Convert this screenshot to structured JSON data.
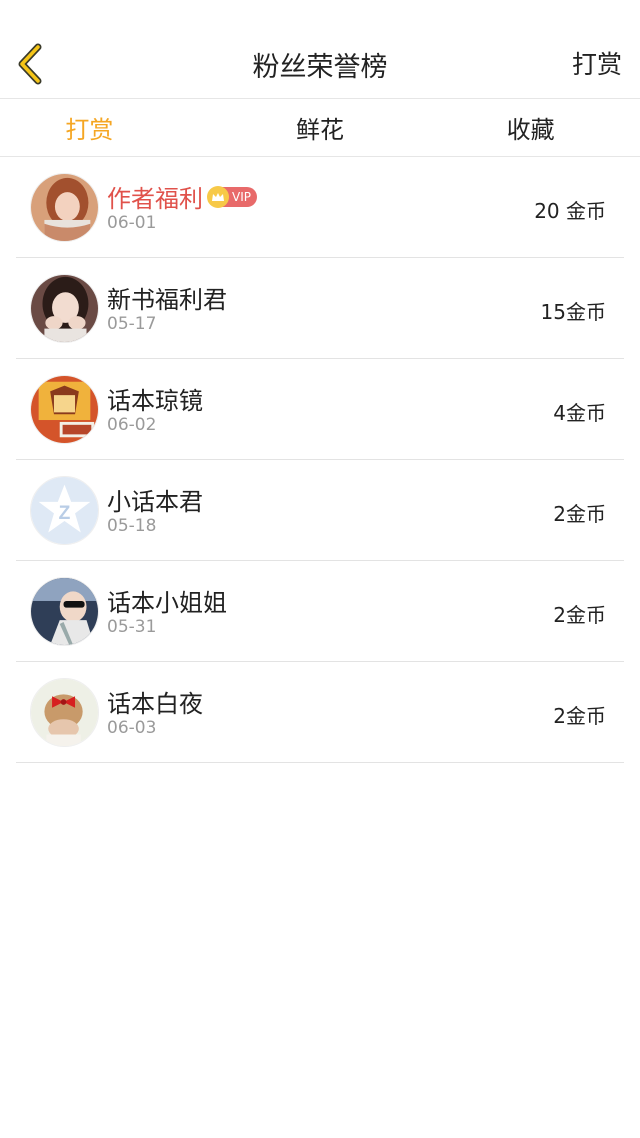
{
  "header": {
    "title": "粉丝荣誉榜",
    "right_action": "打赏"
  },
  "tabs": [
    {
      "label": "打赏",
      "active": true
    },
    {
      "label": "鲜花",
      "active": false
    },
    {
      "label": "收藏",
      "active": false
    }
  ],
  "colors": {
    "accent": "#f5a623",
    "highlight_name": "#e0524b",
    "vip_badge": "#e86a6a"
  },
  "fans": [
    {
      "name": "作者福利",
      "date": "06-01",
      "amount": "20 金币",
      "vip": true,
      "vip_label": "VIP",
      "avatar": "avatar-girl-scarf"
    },
    {
      "name": "新书福利君",
      "date": "05-17",
      "amount": "15金币",
      "vip": false,
      "avatar": "avatar-girl-hands"
    },
    {
      "name": "话本琼镜",
      "date": "06-02",
      "amount": "4金币",
      "vip": false,
      "avatar": "avatar-logo-qiongjing"
    },
    {
      "name": "小话本君",
      "date": "05-18",
      "amount": "2金币",
      "vip": false,
      "avatar": "avatar-default-star"
    },
    {
      "name": "话本小姐姐",
      "date": "05-31",
      "amount": "2金币",
      "vip": false,
      "avatar": "avatar-car-selfie"
    },
    {
      "name": "话本白夜",
      "date": "06-03",
      "amount": "2金币",
      "vip": false,
      "avatar": "avatar-red-bow"
    }
  ]
}
